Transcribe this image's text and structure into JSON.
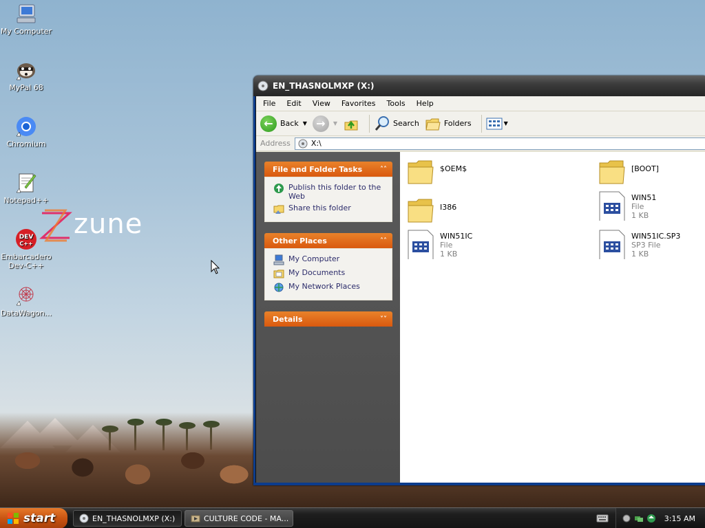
{
  "desktop": {
    "icons": [
      {
        "label": "My Computer",
        "icon": "my-computer-icon"
      },
      {
        "label": "MyPal 68",
        "icon": "mypal-raccoon-icon"
      },
      {
        "label": "Chromium",
        "icon": "chromium-icon"
      },
      {
        "label": "Notepad++",
        "icon": "notepadpp-icon"
      },
      {
        "label": "Embarcadero Dev-C++",
        "icon": "devcpp-icon"
      },
      {
        "label": "DataWagon...",
        "icon": "datawagon-icon"
      }
    ],
    "zune_logo_text": "zune"
  },
  "window": {
    "title": "EN_THASNOLMXP (X:)",
    "menu": [
      "File",
      "Edit",
      "View",
      "Favorites",
      "Tools",
      "Help"
    ],
    "toolbar": {
      "back_label": "Back",
      "search_label": "Search",
      "folders_label": "Folders"
    },
    "address": {
      "label": "Address",
      "value": "X:\\"
    },
    "taskpane": {
      "file_folder_tasks": {
        "title": "File and Folder Tasks",
        "items": [
          "Publish this folder to the Web",
          "Share this folder"
        ]
      },
      "other_places": {
        "title": "Other Places",
        "items": [
          "My Computer",
          "My Documents",
          "My Network Places"
        ]
      },
      "details": {
        "title": "Details"
      }
    },
    "files": [
      {
        "name": "$OEM$",
        "type": "folder"
      },
      {
        "name": "[BOOT]",
        "type": "folder"
      },
      {
        "name": "I386",
        "type": "folder"
      },
      {
        "name": "WIN51",
        "type": "File",
        "size": "1 KB"
      },
      {
        "name": "WIN51IC",
        "type": "File",
        "size": "1 KB"
      },
      {
        "name": "WIN51IC.SP3",
        "type": "SP3 File",
        "size": "1 KB"
      }
    ]
  },
  "taskbar": {
    "start_label": "start",
    "tasks": [
      {
        "label": "EN_THASNOLMXP (X:)",
        "active": true
      },
      {
        "label": "CULTURE CODE - MA...",
        "active": false
      }
    ],
    "clock": "3:15 AM"
  },
  "colors": {
    "accent_orange": "#d9590f",
    "title_dark": "#262626",
    "taskpane_gray": "#4c4c4c",
    "link_text": "#2b2b6a"
  }
}
